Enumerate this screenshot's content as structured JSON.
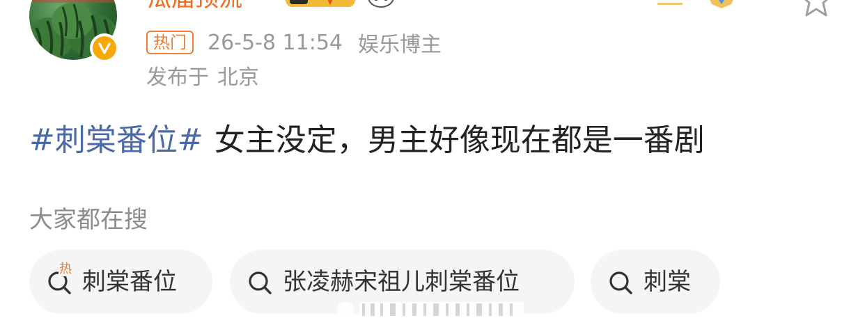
{
  "post": {
    "username": "瓜届顶流",
    "hot_tag": "热门",
    "timestamp": "26-5-8 11:54",
    "role": "娱乐博主",
    "location_prefix": "发布于",
    "location": "北京",
    "hashtag": "#刺棠番位#",
    "body": "女主没定，男主好像现在都是一番剧"
  },
  "search": {
    "title": "大家都在搜",
    "chips": [
      {
        "label": "刺棠番位",
        "icon": "search-hot-icon",
        "hot_mark": "热"
      },
      {
        "label": "张凌赫宋祖儿刺棠番位",
        "icon": "search-icon"
      },
      {
        "label": "刺棠",
        "icon": "search-icon"
      }
    ]
  },
  "colors": {
    "username": "#f06a1a",
    "hashtag": "#4a69a8",
    "hot_tag": "#f07c32",
    "verified_badge": "#f7a90b",
    "meta_text": "#999999",
    "chip_background": "#f5f5f5"
  }
}
